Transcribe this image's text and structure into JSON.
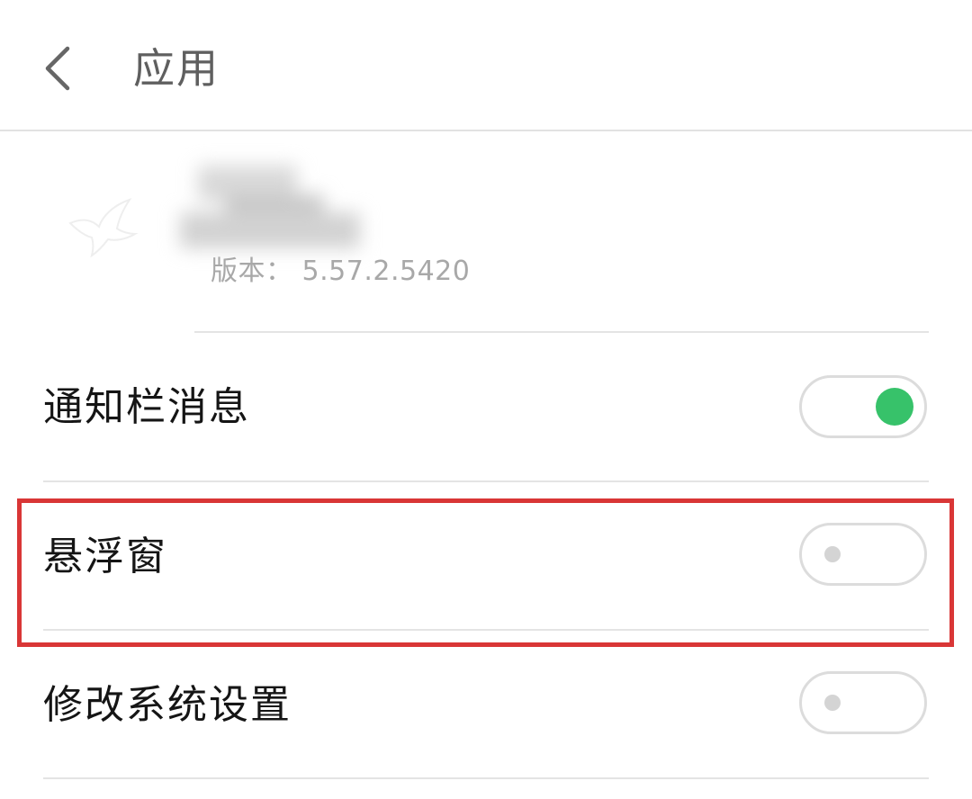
{
  "header": {
    "title": "应用",
    "back_icon": "chevron-left-icon"
  },
  "app_info": {
    "icon": "bird-icon",
    "name_obscured": true,
    "version_text": "版本：  5.57.2.5420"
  },
  "permissions": [
    {
      "label": "通知栏消息",
      "enabled": true
    },
    {
      "label": "悬浮窗",
      "enabled": false,
      "highlighted": true
    },
    {
      "label": "修改系统设置",
      "enabled": false
    }
  ],
  "colors": {
    "toggle_on": "#37c26a",
    "toggle_border": "#dcdcdc",
    "highlight_border": "#d93636",
    "divider": "#e4e4e4"
  }
}
